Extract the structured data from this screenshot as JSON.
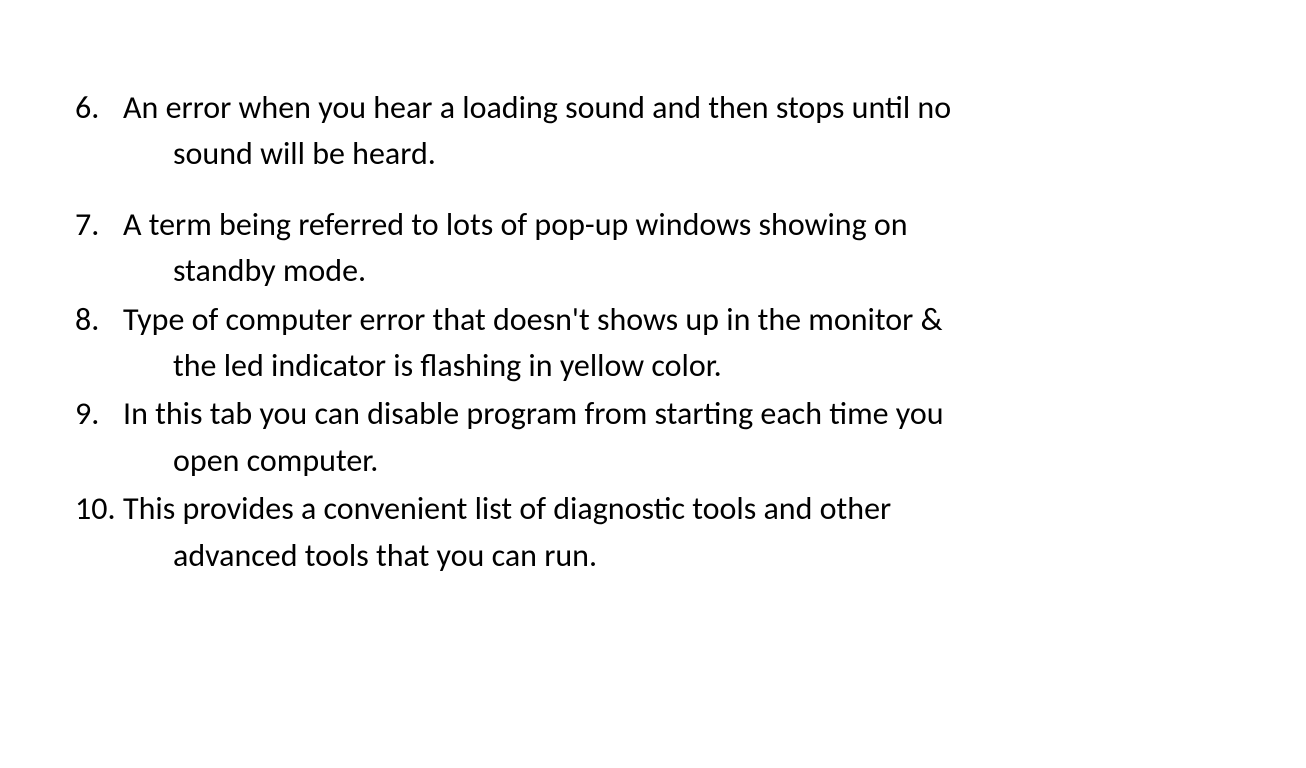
{
  "items": [
    {
      "number": "6.",
      "line1": "An error when you hear a loading sound and then stops until no",
      "line2": "sound will be heard."
    },
    {
      "number": "7.",
      "line1": "A term being referred to lots of pop-up windows showing on",
      "line2": "standby mode."
    },
    {
      "number": "8.",
      "line1": "Type of computer error that doesn't shows up in the monitor &",
      "line2": "the led indicator is flashing in yellow color."
    },
    {
      "number": "9.",
      "line1": "In this tab you can disable program from starting each time you",
      "line2": "open computer."
    },
    {
      "number": "10.",
      "line1": "This provides a convenient list of diagnostic tools and other",
      "line2": "advanced tools that you can run."
    }
  ]
}
